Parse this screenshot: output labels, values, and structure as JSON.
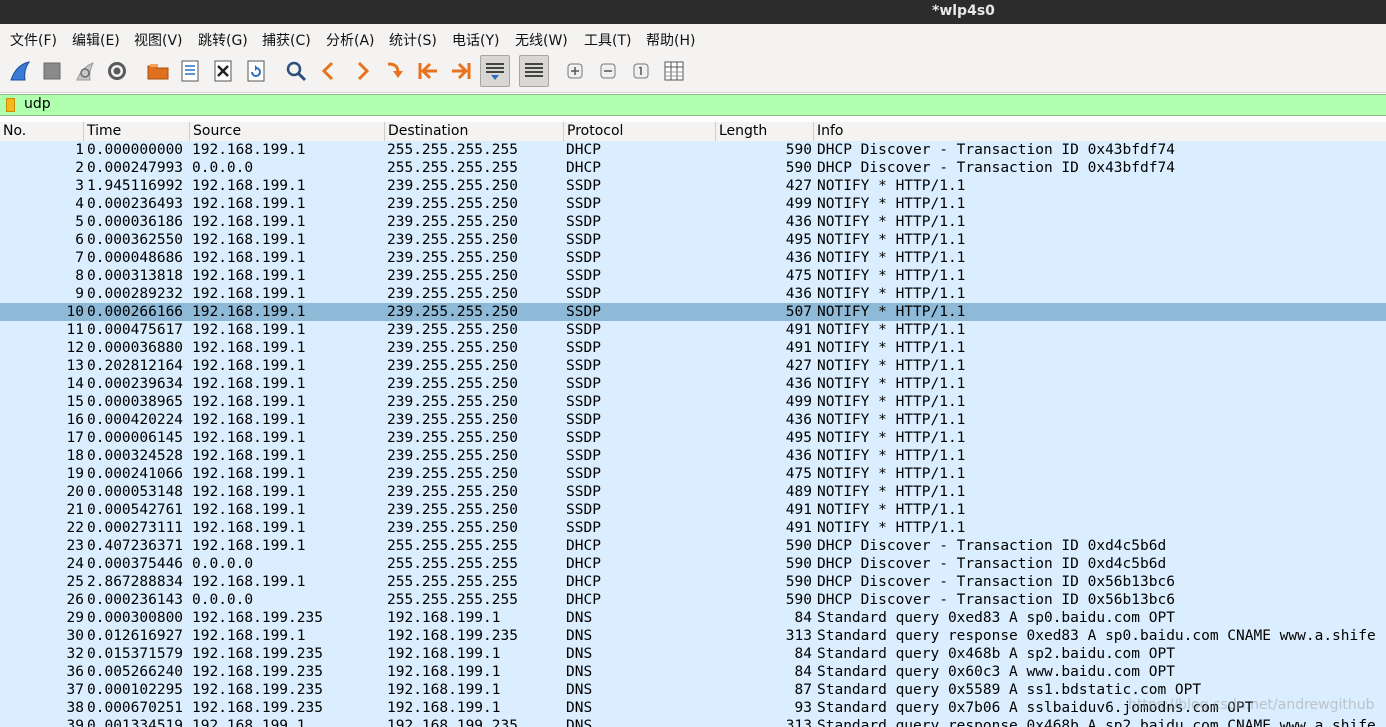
{
  "window": {
    "title": "*wlp4s0"
  },
  "menu": [
    {
      "label": "文件(F)"
    },
    {
      "label": "编辑(E)"
    },
    {
      "label": "视图(V)"
    },
    {
      "label": "跳转(G)"
    },
    {
      "label": "捕获(C)"
    },
    {
      "label": "分析(A)"
    },
    {
      "label": "统计(S)"
    },
    {
      "label": "电话(Y)"
    },
    {
      "label": "无线(W)"
    },
    {
      "label": "工具(T)"
    },
    {
      "label": "帮助(H)"
    }
  ],
  "toolbar_icons": [
    "shark-fin-start-icon",
    "stop-capture-icon",
    "restart-capture-icon",
    "capture-options-gear-icon",
    "open-folder-icon",
    "save-file-icon",
    "close-file-icon",
    "reload-file-icon",
    "find-packet-icon",
    "go-back-icon",
    "go-forward-icon",
    "go-to-packet-icon",
    "first-packet-icon",
    "last-packet-icon",
    "autoscroll-icon",
    "colorize-icon",
    "zoom-in-icon",
    "zoom-out-icon",
    "normal-size-icon",
    "resize-columns-icon"
  ],
  "filter": {
    "value": "udp"
  },
  "columns": [
    "No.",
    "Time",
    "Source",
    "Destination",
    "Protocol",
    "Length",
    "Info"
  ],
  "selected_index": 9,
  "rows": [
    {
      "no": "1",
      "time": "0.000000000",
      "src": "192.168.199.1",
      "dst": "255.255.255.255",
      "proto": "DHCP",
      "len": "590",
      "info": "DHCP Discover - Transaction ID 0x43bfdf74"
    },
    {
      "no": "2",
      "time": "0.000247993",
      "src": "0.0.0.0",
      "dst": "255.255.255.255",
      "proto": "DHCP",
      "len": "590",
      "info": "DHCP Discover - Transaction ID 0x43bfdf74"
    },
    {
      "no": "3",
      "time": "1.945116992",
      "src": "192.168.199.1",
      "dst": "239.255.255.250",
      "proto": "SSDP",
      "len": "427",
      "info": "NOTIFY * HTTP/1.1"
    },
    {
      "no": "4",
      "time": "0.000236493",
      "src": "192.168.199.1",
      "dst": "239.255.255.250",
      "proto": "SSDP",
      "len": "499",
      "info": "NOTIFY * HTTP/1.1"
    },
    {
      "no": "5",
      "time": "0.000036186",
      "src": "192.168.199.1",
      "dst": "239.255.255.250",
      "proto": "SSDP",
      "len": "436",
      "info": "NOTIFY * HTTP/1.1"
    },
    {
      "no": "6",
      "time": "0.000362550",
      "src": "192.168.199.1",
      "dst": "239.255.255.250",
      "proto": "SSDP",
      "len": "495",
      "info": "NOTIFY * HTTP/1.1"
    },
    {
      "no": "7",
      "time": "0.000048686",
      "src": "192.168.199.1",
      "dst": "239.255.255.250",
      "proto": "SSDP",
      "len": "436",
      "info": "NOTIFY * HTTP/1.1"
    },
    {
      "no": "8",
      "time": "0.000313818",
      "src": "192.168.199.1",
      "dst": "239.255.255.250",
      "proto": "SSDP",
      "len": "475",
      "info": "NOTIFY * HTTP/1.1"
    },
    {
      "no": "9",
      "time": "0.000289232",
      "src": "192.168.199.1",
      "dst": "239.255.255.250",
      "proto": "SSDP",
      "len": "436",
      "info": "NOTIFY * HTTP/1.1"
    },
    {
      "no": "10",
      "time": "0.000266166",
      "src": "192.168.199.1",
      "dst": "239.255.255.250",
      "proto": "SSDP",
      "len": "507",
      "info": "NOTIFY * HTTP/1.1"
    },
    {
      "no": "11",
      "time": "0.000475617",
      "src": "192.168.199.1",
      "dst": "239.255.255.250",
      "proto": "SSDP",
      "len": "491",
      "info": "NOTIFY * HTTP/1.1"
    },
    {
      "no": "12",
      "time": "0.000036880",
      "src": "192.168.199.1",
      "dst": "239.255.255.250",
      "proto": "SSDP",
      "len": "491",
      "info": "NOTIFY * HTTP/1.1"
    },
    {
      "no": "13",
      "time": "0.202812164",
      "src": "192.168.199.1",
      "dst": "239.255.255.250",
      "proto": "SSDP",
      "len": "427",
      "info": "NOTIFY * HTTP/1.1"
    },
    {
      "no": "14",
      "time": "0.000239634",
      "src": "192.168.199.1",
      "dst": "239.255.255.250",
      "proto": "SSDP",
      "len": "436",
      "info": "NOTIFY * HTTP/1.1"
    },
    {
      "no": "15",
      "time": "0.000038965",
      "src": "192.168.199.1",
      "dst": "239.255.255.250",
      "proto": "SSDP",
      "len": "499",
      "info": "NOTIFY * HTTP/1.1"
    },
    {
      "no": "16",
      "time": "0.000420224",
      "src": "192.168.199.1",
      "dst": "239.255.255.250",
      "proto": "SSDP",
      "len": "436",
      "info": "NOTIFY * HTTP/1.1"
    },
    {
      "no": "17",
      "time": "0.000006145",
      "src": "192.168.199.1",
      "dst": "239.255.255.250",
      "proto": "SSDP",
      "len": "495",
      "info": "NOTIFY * HTTP/1.1"
    },
    {
      "no": "18",
      "time": "0.000324528",
      "src": "192.168.199.1",
      "dst": "239.255.255.250",
      "proto": "SSDP",
      "len": "436",
      "info": "NOTIFY * HTTP/1.1"
    },
    {
      "no": "19",
      "time": "0.000241066",
      "src": "192.168.199.1",
      "dst": "239.255.255.250",
      "proto": "SSDP",
      "len": "475",
      "info": "NOTIFY * HTTP/1.1"
    },
    {
      "no": "20",
      "time": "0.000053148",
      "src": "192.168.199.1",
      "dst": "239.255.255.250",
      "proto": "SSDP",
      "len": "489",
      "info": "NOTIFY * HTTP/1.1"
    },
    {
      "no": "21",
      "time": "0.000542761",
      "src": "192.168.199.1",
      "dst": "239.255.255.250",
      "proto": "SSDP",
      "len": "491",
      "info": "NOTIFY * HTTP/1.1"
    },
    {
      "no": "22",
      "time": "0.000273111",
      "src": "192.168.199.1",
      "dst": "239.255.255.250",
      "proto": "SSDP",
      "len": "491",
      "info": "NOTIFY * HTTP/1.1"
    },
    {
      "no": "23",
      "time": "0.407236371",
      "src": "192.168.199.1",
      "dst": "255.255.255.255",
      "proto": "DHCP",
      "len": "590",
      "info": "DHCP Discover - Transaction ID 0xd4c5b6d"
    },
    {
      "no": "24",
      "time": "0.000375446",
      "src": "0.0.0.0",
      "dst": "255.255.255.255",
      "proto": "DHCP",
      "len": "590",
      "info": "DHCP Discover - Transaction ID 0xd4c5b6d"
    },
    {
      "no": "25",
      "time": "2.867288834",
      "src": "192.168.199.1",
      "dst": "255.255.255.255",
      "proto": "DHCP",
      "len": "590",
      "info": "DHCP Discover - Transaction ID 0x56b13bc6"
    },
    {
      "no": "26",
      "time": "0.000236143",
      "src": "0.0.0.0",
      "dst": "255.255.255.255",
      "proto": "DHCP",
      "len": "590",
      "info": "DHCP Discover - Transaction ID 0x56b13bc6"
    },
    {
      "no": "29",
      "time": "0.000300800",
      "src": "192.168.199.235",
      "dst": "192.168.199.1",
      "proto": "DNS",
      "len": "84",
      "info": "Standard query 0xed83 A sp0.baidu.com OPT"
    },
    {
      "no": "30",
      "time": "0.012616927",
      "src": "192.168.199.1",
      "dst": "192.168.199.235",
      "proto": "DNS",
      "len": "313",
      "info": "Standard query response 0xed83 A sp0.baidu.com CNAME www.a.shife"
    },
    {
      "no": "32",
      "time": "0.015371579",
      "src": "192.168.199.235",
      "dst": "192.168.199.1",
      "proto": "DNS",
      "len": "84",
      "info": "Standard query 0x468b A sp2.baidu.com OPT"
    },
    {
      "no": "36",
      "time": "0.005266240",
      "src": "192.168.199.235",
      "dst": "192.168.199.1",
      "proto": "DNS",
      "len": "84",
      "info": "Standard query 0x60c3 A www.baidu.com OPT"
    },
    {
      "no": "37",
      "time": "0.000102295",
      "src": "192.168.199.235",
      "dst": "192.168.199.1",
      "proto": "DNS",
      "len": "87",
      "info": "Standard query 0x5589 A ss1.bdstatic.com OPT"
    },
    {
      "no": "38",
      "time": "0.000670251",
      "src": "192.168.199.235",
      "dst": "192.168.199.1",
      "proto": "DNS",
      "len": "93",
      "info": "Standard query 0x7b06 A sslbaiduv6.jomodns.com OPT"
    },
    {
      "no": "39",
      "time": "0.001334519",
      "src": "192.168.199.1",
      "dst": "192.168.199.235",
      "proto": "DNS",
      "len": "313",
      "info": "Standard query response 0x468b A sp2.baidu.com CNAME www.a.shife"
    }
  ],
  "watermark": "https://blog.csdn.net/andrewgithub",
  "colors": {
    "row_bg": "#daeeff",
    "row_selected": "#8ebad8",
    "filter_valid": "#afffaf",
    "titlebar": "#2c2c2c"
  }
}
